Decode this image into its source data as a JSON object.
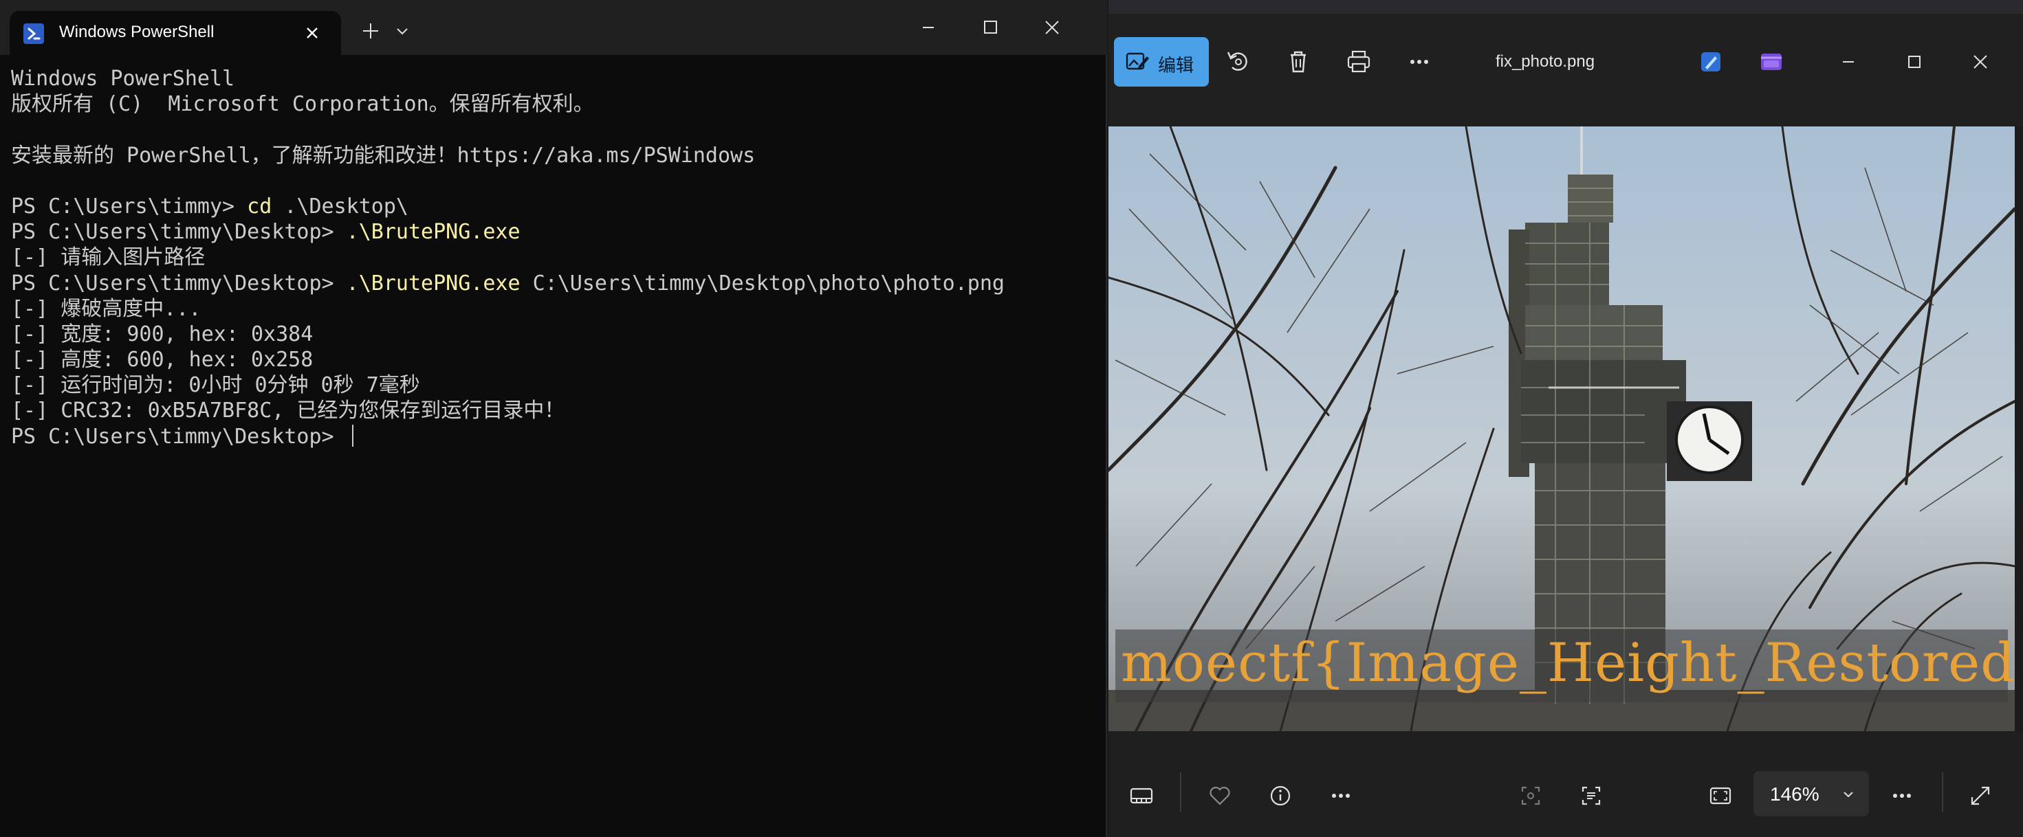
{
  "terminal": {
    "tab_title": "Windows PowerShell",
    "lines": [
      {
        "segs": [
          {
            "t": "Windows PowerShell",
            "c": "out"
          }
        ]
      },
      {
        "segs": [
          {
            "t": "版权所有 (C)  Microsoft Corporation。保留所有权利。",
            "c": "out"
          }
        ]
      },
      {
        "segs": [
          {
            "t": "",
            "c": "out"
          }
        ]
      },
      {
        "segs": [
          {
            "t": "安装最新的 PowerShell，了解新功能和改进！https://aka.ms/PSWindows",
            "c": "out"
          }
        ]
      },
      {
        "segs": [
          {
            "t": "",
            "c": "out"
          }
        ]
      },
      {
        "segs": [
          {
            "t": "PS C:\\Users\\timmy> ",
            "c": "out"
          },
          {
            "t": "cd",
            "c": "cmd"
          },
          {
            "t": " .\\Desktop\\",
            "c": "out"
          }
        ]
      },
      {
        "segs": [
          {
            "t": "PS C:\\Users\\timmy\\Desktop> ",
            "c": "out"
          },
          {
            "t": ".\\BrutePNG.exe",
            "c": "cmd"
          }
        ]
      },
      {
        "segs": [
          {
            "t": "[-] 请输入图片路径",
            "c": "out"
          }
        ]
      },
      {
        "segs": [
          {
            "t": "PS C:\\Users\\timmy\\Desktop> ",
            "c": "out"
          },
          {
            "t": ".\\BrutePNG.exe",
            "c": "cmd"
          },
          {
            "t": " C:\\Users\\timmy\\Desktop\\photo\\photo.png",
            "c": "out"
          }
        ]
      },
      {
        "segs": [
          {
            "t": "[-] 爆破高度中...",
            "c": "out"
          }
        ]
      },
      {
        "segs": [
          {
            "t": "[-] 宽度: 900, hex: 0x384",
            "c": "out"
          }
        ]
      },
      {
        "segs": [
          {
            "t": "[-] 高度: 600, hex: 0x258",
            "c": "out"
          }
        ]
      },
      {
        "segs": [
          {
            "t": "[-] 运行时间为: 0小时 0分钟 0秒 7毫秒",
            "c": "out"
          }
        ]
      },
      {
        "segs": [
          {
            "t": "[-] CRC32: 0xB5A7BF8C, 已经为您保存到运行目录中！",
            "c": "out"
          }
        ]
      },
      {
        "segs": [
          {
            "t": "PS C:\\Users\\timmy\\Desktop> ",
            "c": "out"
          }
        ],
        "cursor": true
      }
    ]
  },
  "photos": {
    "edit_label": "编辑",
    "filename": "fix_photo.png",
    "flag_text": "moectf{Image_Height_Restored}",
    "zoom": "146%",
    "accent": "#4aa1e8",
    "flag_color": "#e8a23a",
    "toolbar_icons": [
      "rotate-icon",
      "delete-icon",
      "print-icon",
      "more-icon"
    ],
    "bottom_icons": [
      "filmstrip-icon",
      "favorite-icon",
      "info-icon",
      "more-icon",
      "crop-region-icon",
      "text-scan-icon",
      "fit-window-icon",
      "more-icon",
      "expand-icon"
    ]
  }
}
